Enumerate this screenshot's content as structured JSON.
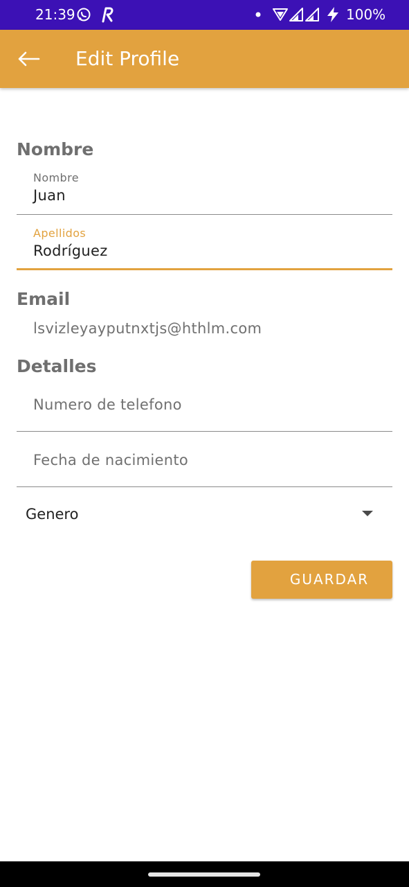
{
  "status_bar": {
    "time": "21:39",
    "battery": "100%",
    "icons": [
      "whatsapp-icon",
      "r-app-icon",
      "notification-dot-icon",
      "wifi-icon",
      "signal-icon",
      "signal-icon",
      "charging-icon"
    ]
  },
  "app_bar": {
    "title": "Edit Profile",
    "back_icon": "arrow-back-icon",
    "background": "#e2a23f"
  },
  "sections": {
    "name_title": "Nombre",
    "email_title": "Email",
    "details_title": "Detalles"
  },
  "fields": {
    "first_name": {
      "label": "Nombre",
      "value": "Juan"
    },
    "last_name": {
      "label": "Apellidos",
      "value": "Rodríguez",
      "focused": true
    },
    "email_value": "lsvizleyayputnxtjs@hthlm.com",
    "phone": {
      "placeholder": "Numero de telefono"
    },
    "birthdate": {
      "placeholder": "Fecha de nacimiento"
    },
    "gender": {
      "value": "Genero"
    }
  },
  "actions": {
    "save_label": "GUARDAR"
  },
  "colors": {
    "accent": "#e2a23f",
    "status_bar": "#3c11b5"
  }
}
